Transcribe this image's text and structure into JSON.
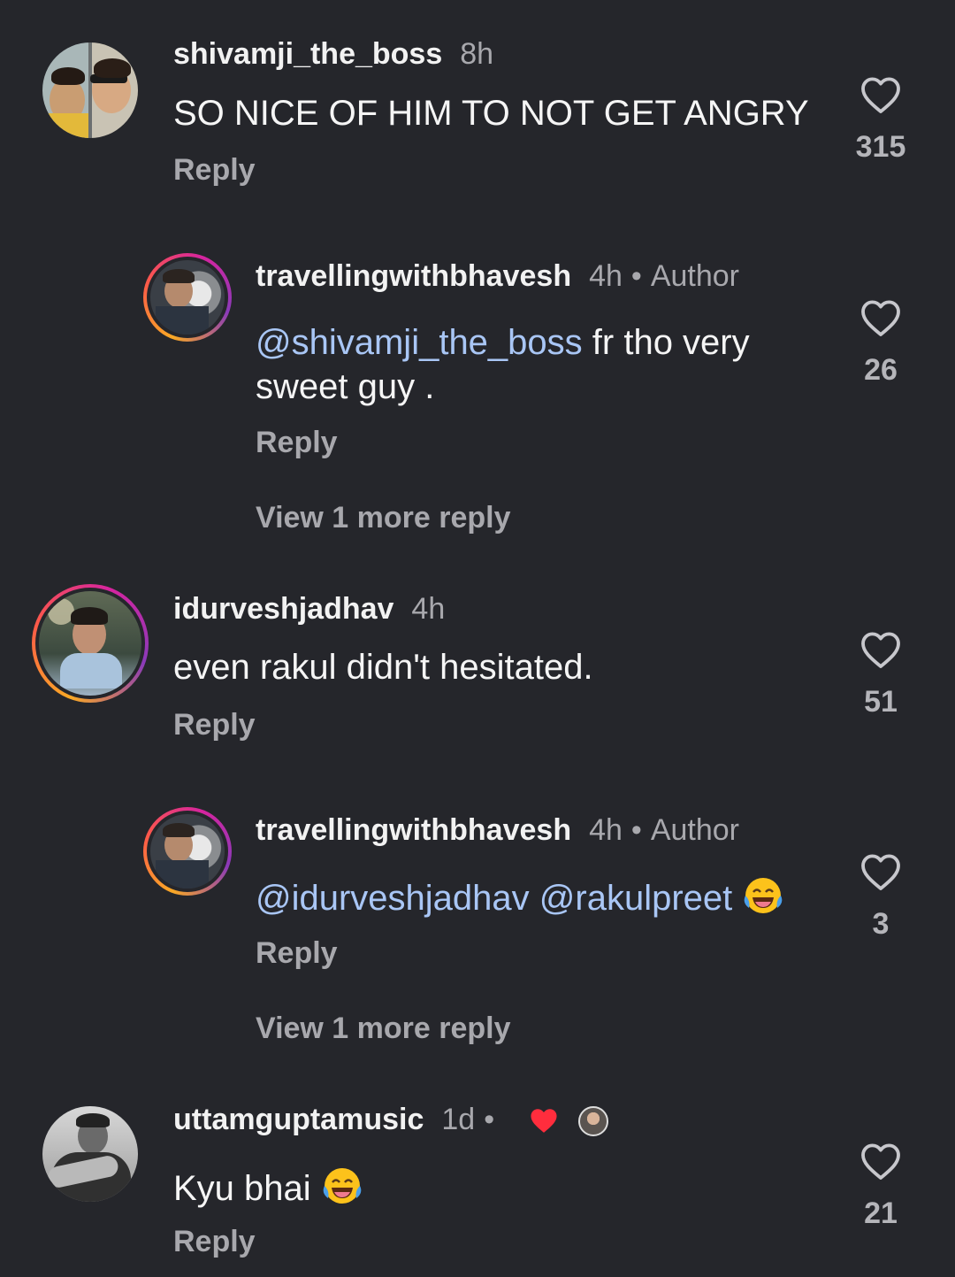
{
  "comments": [
    {
      "username": "shivamji_the_boss",
      "time": "8h",
      "text": "SO NICE OF HIM TO NOT GET ANGRY",
      "reply_label": "Reply",
      "likes": "315"
    },
    {
      "username": "travellingwithbhavesh",
      "time": "4h",
      "author_label": "Author",
      "mention": "@shivamji_the_boss",
      "text": " fr tho very sweet guy .",
      "reply_label": "Reply",
      "likes": "26",
      "view_more": "View 1 more reply"
    },
    {
      "username": "idurveshjadhav",
      "time": "4h",
      "text": "even rakul didn't hesitated.",
      "reply_label": "Reply",
      "likes": "51"
    },
    {
      "username": "travellingwithbhavesh",
      "time": "4h",
      "author_label": "Author",
      "mention1": "@idurveshjadhav",
      "mention2": "@rakulpreet",
      "reply_label": "Reply",
      "likes": "3",
      "view_more": "View 1 more reply"
    },
    {
      "username": "uttamguptamusic",
      "time": "1d",
      "text": "Kyu bhai",
      "reply_label": "Reply",
      "likes": "21"
    }
  ],
  "colors": {
    "background": "#25262b",
    "mention": "#a9c6f5",
    "secondary_text": "#a8a8ad",
    "creator_liked_heart": "#ff2d3d"
  },
  "icons": {
    "like": "heart-outline-icon",
    "reaction_emoji": "face-with-tears-of-joy-emoji",
    "creator_liked": "red-heart-icon"
  }
}
